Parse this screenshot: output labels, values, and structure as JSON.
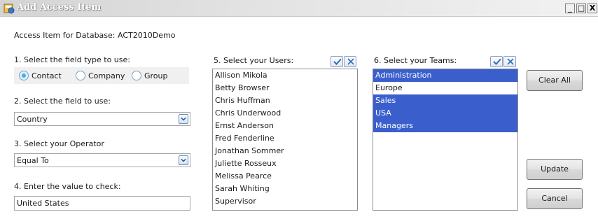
{
  "window": {
    "title": "Add Access Item",
    "app_icon": "app-icon",
    "controls": {
      "minimize": "_",
      "maximize": "□",
      "close": "X"
    }
  },
  "header": {
    "label": "Access Item for Database:",
    "database": "ACT2010Demo"
  },
  "field_type": {
    "label": "1. Select the field type to use:",
    "options": [
      "Contact",
      "Company",
      "Group"
    ],
    "selected": "Contact"
  },
  "field": {
    "label": "2. Select the field to use:",
    "value": "Country"
  },
  "operator": {
    "label": "3. Select your Operator",
    "value": "Equal To"
  },
  "value_check": {
    "label": "4. Enter the value to check:",
    "value": "United States"
  },
  "users": {
    "label": "5. Select your Users:",
    "items": [
      "Allison Mikola",
      "Betty Browser",
      "Chris Huffman",
      "Chris Underwood",
      "Ernst Anderson",
      "Fred Fenderline",
      "Jonathan Sommer",
      "Juliette Rosseux",
      "Melissa Pearce",
      "Sarah Whiting",
      "Supervisor"
    ],
    "selected": []
  },
  "teams": {
    "label": "6. Select your Teams:",
    "items": [
      "Administration",
      "Europe",
      "Sales",
      "USA",
      "Managers"
    ],
    "selected": [
      "Administration",
      "Sales",
      "USA",
      "Managers"
    ]
  },
  "buttons": {
    "clear_all": "Clear All",
    "update": "Update",
    "cancel": "Cancel"
  },
  "colors": {
    "selection": "#3a5fcd",
    "check_icon": "#2f6fb8",
    "clear_icon": "#2f6fb8"
  }
}
